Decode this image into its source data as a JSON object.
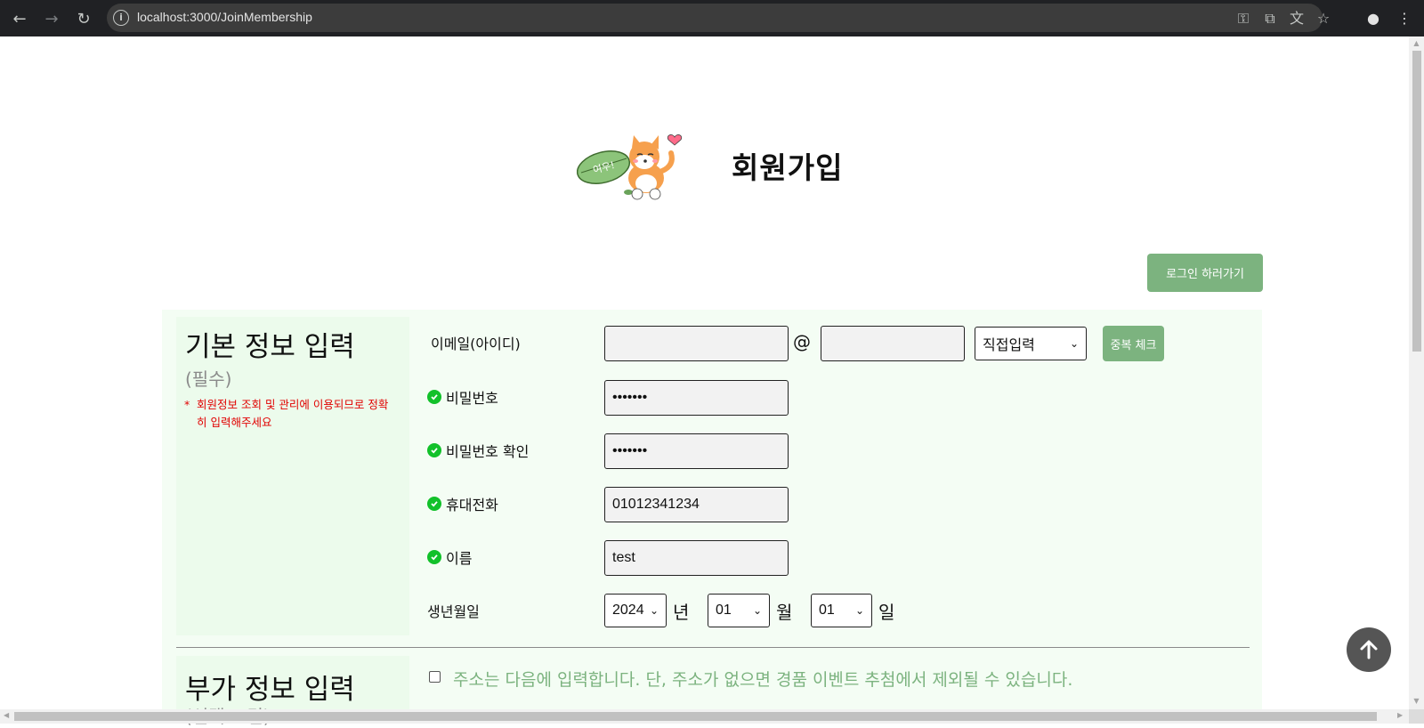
{
  "browser": {
    "url": "localhost:3000/JoinMembership",
    "back_icon": "back-arrow-icon",
    "forward_icon": "forward-arrow-icon",
    "reload_icon": "reload-icon"
  },
  "header": {
    "title": "회원가입",
    "mascot_text": "여우!"
  },
  "login_button": "로그인 하러가기",
  "basic_section": {
    "title": "기본 정보 입력",
    "subtitle": "(필수)",
    "note_star": "*",
    "note": "회원정보 조회 및 관리에 이용되므로 정확히 입력해주세요"
  },
  "fields": {
    "email_label": "이메일(아이디)",
    "email_local": "",
    "at": "@",
    "email_domain": "",
    "domain_select": "직접입력",
    "dup_check": "중복 체크",
    "password_label": "비밀번호",
    "password_value": "•••••••",
    "password_confirm_label": "비밀번호 확인",
    "password_confirm_value": "•••••••",
    "phone_label": "휴대전화",
    "phone_value": "01012341234",
    "name_label": "이름",
    "name_value": "test",
    "birth_label": "생년월일",
    "birth_year": "2024",
    "year_unit": "년",
    "birth_month": "01",
    "month_unit": "월",
    "birth_day": "01",
    "day_unit": "일"
  },
  "extra_section": {
    "title": "부가 정보 입력",
    "subtitle": "(선택 조건)",
    "address_note": "주소는 다음에 입력합니다. 단, 주소가 없으면 경품 이벤트 추첨에서 제외될 수 있습니다."
  },
  "colors": {
    "accent_green": "#7cb37f",
    "check_green": "#12c12a",
    "required_red": "#e10000",
    "panel_bg": "#f4fdf4"
  }
}
